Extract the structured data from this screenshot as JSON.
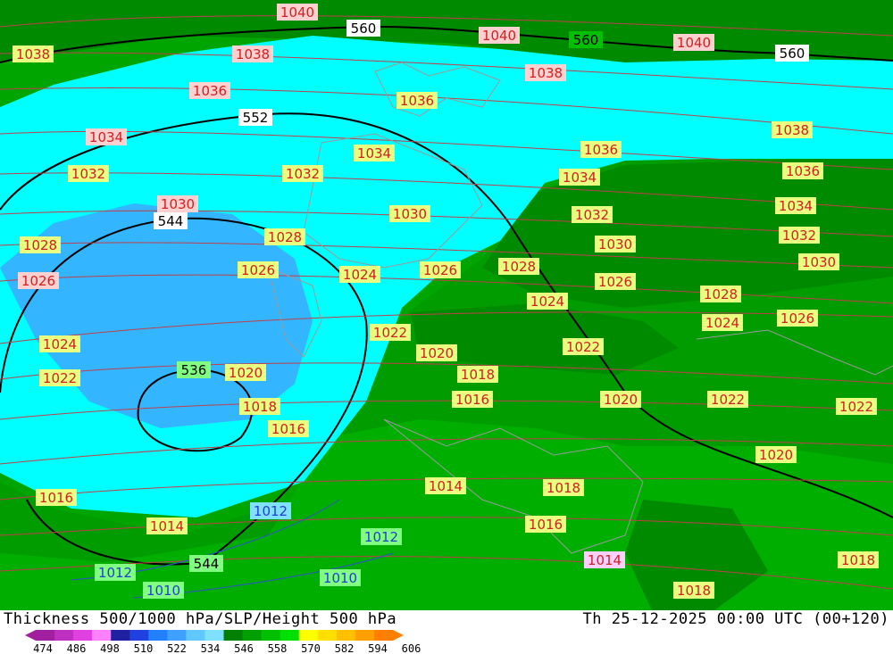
{
  "footer": {
    "title": "Thickness 500/1000 hPa/SLP/Height 500 hPa",
    "time": "Th 25-12-2025 00:00 UTC (00+120)"
  },
  "colorbar": {
    "colors": [
      "#a020a0",
      "#c030c0",
      "#e040e0",
      "#ff80ff",
      "#2020a0",
      "#2040e0",
      "#2080ff",
      "#40a0ff",
      "#60c8ff",
      "#80e0ff",
      "#008000",
      "#00a000",
      "#00c000",
      "#00e000",
      "#ffff00",
      "#ffe000",
      "#ffc000",
      "#ffa000",
      "#ff8000"
    ],
    "ticks": [
      "474",
      "486",
      "498",
      "510",
      "522",
      "534",
      "546",
      "558",
      "570",
      "582",
      "594",
      "606"
    ]
  },
  "height_labels": [
    "560",
    "560",
    "560",
    "552",
    "544",
    "536",
    "544"
  ],
  "pressure_labels": [
    "1040",
    "1040",
    "1040",
    "1038",
    "1038",
    "1038",
    "1038",
    "1036",
    "1036",
    "1036",
    "1036",
    "1034",
    "1034",
    "1034",
    "1034",
    "1032",
    "1032",
    "1032",
    "1032",
    "1030",
    "1030",
    "1030",
    "1030",
    "1028",
    "1028",
    "1028",
    "1028",
    "1026",
    "1026",
    "1026",
    "1026",
    "1026",
    "1024",
    "1024",
    "1024",
    "1024",
    "1022",
    "1022",
    "1022",
    "1022",
    "1022",
    "1020",
    "1020",
    "1020",
    "1020",
    "1018",
    "1018",
    "1018",
    "1018",
    "1018",
    "1016",
    "1016",
    "1016",
    "1016",
    "1014",
    "1014",
    "1014",
    "1012",
    "1012",
    "1012",
    "1010",
    "1010"
  ]
}
